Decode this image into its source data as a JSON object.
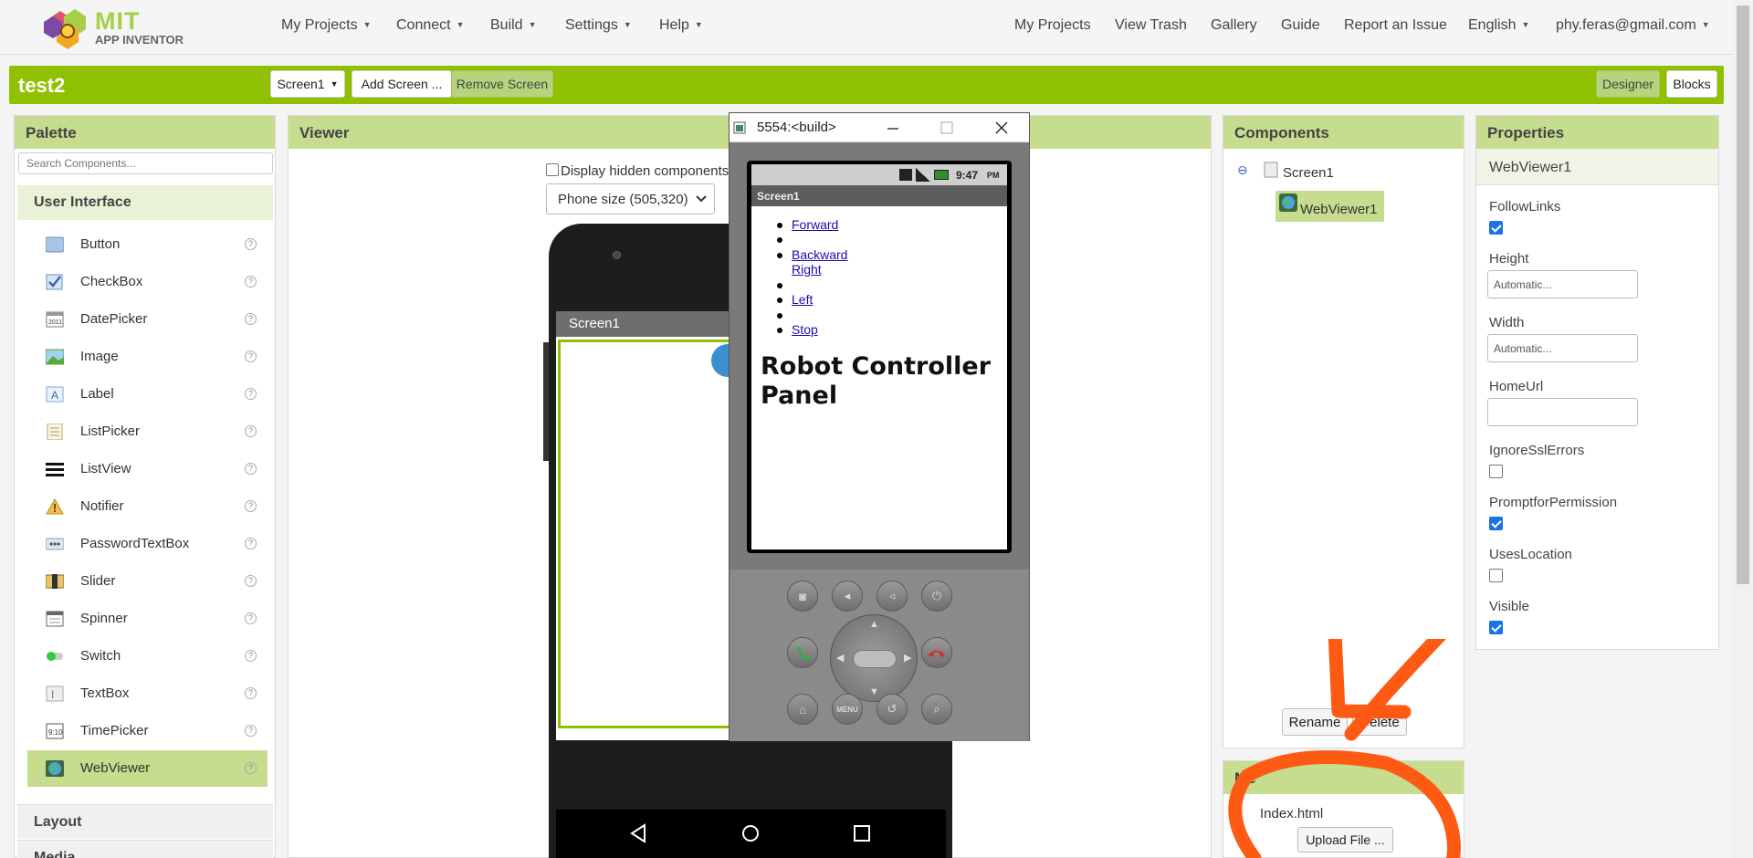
{
  "topbar": {
    "logo_line1": "MIT",
    "logo_line2": "APP INVENTOR",
    "menus": [
      "My Projects",
      "Connect",
      "Build",
      "Settings",
      "Help"
    ],
    "links": [
      "My Projects",
      "View Trash",
      "Gallery",
      "Guide",
      "Report an Issue"
    ],
    "language": "English",
    "account": "phy.feras@gmail.com"
  },
  "project": {
    "name": "test2",
    "screen_select": "Screen1",
    "add_screen": "Add Screen ...",
    "remove_screen": "Remove Screen",
    "designer": "Designer",
    "blocks": "Blocks"
  },
  "palette": {
    "title": "Palette",
    "search_placeholder": "Search Components...",
    "category": "User Interface",
    "items": [
      "Button",
      "CheckBox",
      "DatePicker",
      "Image",
      "Label",
      "ListPicker",
      "ListView",
      "Notifier",
      "PasswordTextBox",
      "Slider",
      "Spinner",
      "Switch",
      "TextBox",
      "TimePicker",
      "WebViewer"
    ],
    "selected": "WebViewer",
    "help_glyph": "?",
    "more_categories": [
      "Layout",
      "Media"
    ]
  },
  "viewer": {
    "title": "Viewer",
    "display_hidden": "Display hidden components",
    "phone_size": "Phone size (505,320)",
    "screen_title": "Screen1"
  },
  "emulator": {
    "window_title": "5554:<build>",
    "status_time": "9:47",
    "status_ampm": "PM",
    "app_title": "Screen1",
    "links": [
      "Forward",
      "Backward",
      "Right",
      "Left",
      "Stop"
    ],
    "heading_line1": "Robot Controller",
    "heading_line2": "Panel",
    "menu_key": "MENU"
  },
  "components": {
    "title": "Components",
    "tree": [
      "Screen1",
      "WebViewer1"
    ],
    "collapse_glyph": "⊖",
    "rename": "Rename",
    "delete": "Delete"
  },
  "media": {
    "title": "Me",
    "file": "Index.html",
    "upload": "Upload File ..."
  },
  "properties": {
    "title": "Properties",
    "component": "WebViewer1",
    "follow_links": "FollowLinks",
    "height": "Height",
    "height_value": "Automatic...",
    "width": "Width",
    "width_value": "Automatic...",
    "home_url": "HomeUrl",
    "ignore_ssl": "IgnoreSslErrors",
    "prompt_permission": "PromptforPermission",
    "uses_location": "UsesLocation",
    "visible": "Visible"
  },
  "annotation_color": "#ff5a14",
  "accent_color": "#8fc100"
}
